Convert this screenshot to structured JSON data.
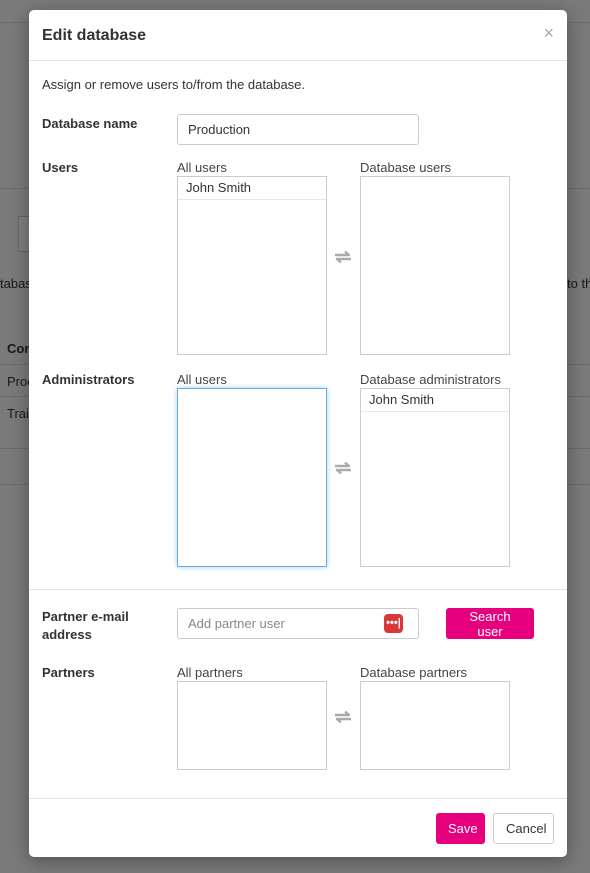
{
  "background": {
    "text_left_1": "tabas",
    "text_right_1": "to th",
    "col_header": "Con",
    "row1": "Proc",
    "row2": "Trair"
  },
  "modal": {
    "title": "Edit database",
    "close_label": "×",
    "intro": "Assign or remove users to/from the database.",
    "database_name": {
      "label": "Database name",
      "value": "Production"
    },
    "users": {
      "label": "Users",
      "left_caption": "All users",
      "right_caption": "Database users",
      "left_items": [
        "John Smith"
      ],
      "right_items": []
    },
    "administrators": {
      "label": "Administrators",
      "left_caption": "All users",
      "right_caption": "Database administrators",
      "left_items": [],
      "right_items": [
        "John Smith"
      ]
    },
    "partner_email": {
      "label": "Partner e-mail address",
      "placeholder": "Add partner user",
      "search_button": "Search user",
      "password_icon_glyph": "•••|"
    },
    "partners": {
      "label": "Partners",
      "left_caption": "All partners",
      "right_caption": "Database partners",
      "left_items": [],
      "right_items": []
    },
    "footer": {
      "save_label": "Save",
      "cancel_label": "Cancel"
    }
  },
  "colors": {
    "accent": "#e6007e",
    "focus_border": "#66afe9",
    "password_icon": "#d9383a",
    "swap_icon": "#aaaaaa"
  },
  "icons": {
    "close": "close-icon",
    "swap": "swap-arrows-icon",
    "password_manager": "password-manager-icon"
  }
}
